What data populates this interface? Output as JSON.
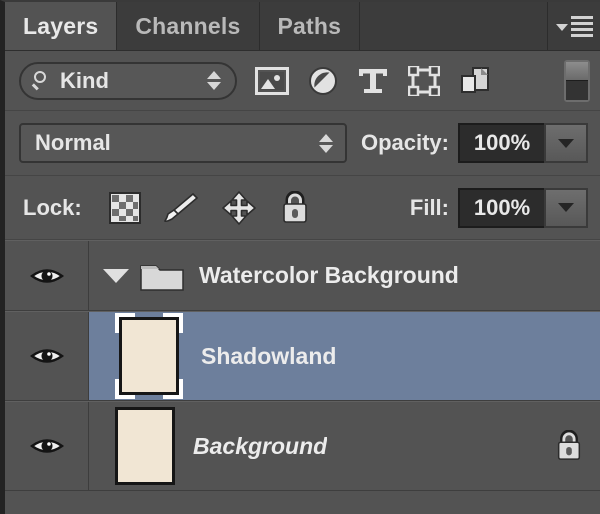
{
  "panel": {
    "tabs": [
      {
        "label": "Layers",
        "active": true
      },
      {
        "label": "Channels",
        "active": false
      },
      {
        "label": "Paths",
        "active": false
      }
    ],
    "menu_icon": "panel-menu-icon"
  },
  "filter": {
    "kind_label": "Kind",
    "search_icon": "magnifier-icon",
    "stepper_icon": "updown-stepper-icon",
    "type_filters": [
      {
        "name": "filter-pixel-layers",
        "icon": "image-icon"
      },
      {
        "name": "filter-adjustment-layers",
        "icon": "adjustment-circle-icon"
      },
      {
        "name": "filter-type-layers",
        "icon": "text-t-icon"
      },
      {
        "name": "filter-shape-layers",
        "icon": "shape-path-icon"
      },
      {
        "name": "filter-smart-objects",
        "icon": "smart-object-icon"
      }
    ],
    "toggle_icon": "filter-enable-switch-icon"
  },
  "blend": {
    "mode": "Normal",
    "mode_stepper_icon": "updown-stepper-icon",
    "opacity_label": "Opacity:",
    "opacity_value": "100%",
    "opacity_arrow_icon": "chevron-down-icon"
  },
  "lock": {
    "label": "Lock:",
    "items": [
      {
        "name": "lock-transparent-pixels",
        "icon": "checkerboard-icon"
      },
      {
        "name": "lock-image-pixels",
        "icon": "paintbrush-icon"
      },
      {
        "name": "lock-position",
        "icon": "move-arrows-icon"
      },
      {
        "name": "lock-all",
        "icon": "padlock-icon"
      }
    ],
    "fill_label": "Fill:",
    "fill_value": "100%",
    "fill_arrow_icon": "chevron-down-icon"
  },
  "layers": [
    {
      "name": "Watercolor Background",
      "type": "group",
      "visible": true,
      "expanded": true,
      "selected": false,
      "italic": false,
      "locked": false,
      "eye_icon": "eye-icon",
      "folder_icon": "folder-open-icon",
      "disclosure_icon": "triangle-down-icon"
    },
    {
      "name": "Shadowland",
      "type": "pixel",
      "visible": true,
      "selected": true,
      "italic": false,
      "locked": false,
      "eye_icon": "eye-icon",
      "thumbnail_color": "#f1e6d4"
    },
    {
      "name": "Background",
      "type": "pixel",
      "visible": true,
      "selected": false,
      "italic": true,
      "locked": true,
      "eye_icon": "eye-icon",
      "lock_icon": "padlock-icon",
      "thumbnail_color": "#f1e6d4"
    }
  ],
  "colors": {
    "panel_bg": "#535353",
    "tab_bg": "#3c3c3c",
    "selection": "#6d7f9c",
    "thumbnail": "#f1e6d4",
    "text": "#ececec"
  }
}
